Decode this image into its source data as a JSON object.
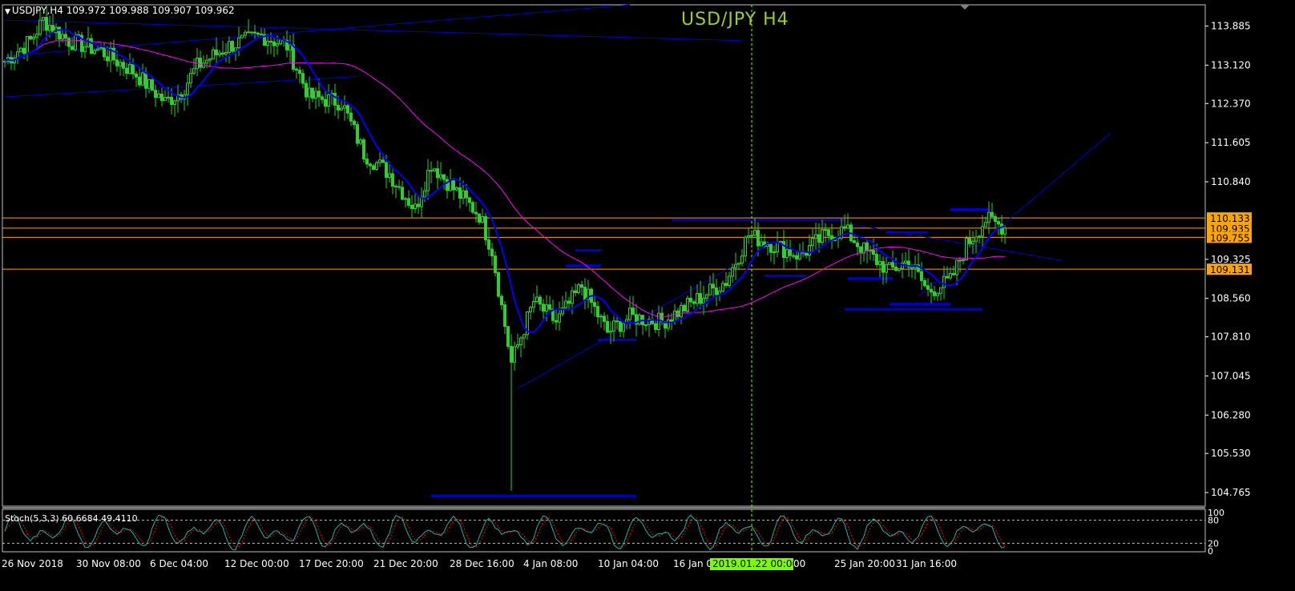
{
  "header": {
    "symbol": "USDJPY,H4",
    "ohlc": "109.972 109.988 109.907 109.962"
  },
  "title": "USD/JPY  H4",
  "stoch_label": "Stoch(5,3,3) 60.6684 49.4110",
  "colors": {
    "background": "#000000",
    "candle": "#32cd32",
    "ma_fast": "#0000ff",
    "ma_slow": "#ff00ff",
    "trendline": "#0000cd",
    "level_line": "#ffa500",
    "grid_text": "#ffffff",
    "title": "#9acd32",
    "crosshair": "#7cfc00"
  },
  "chart_data": [
    {
      "type": "candlestick",
      "title": "USD/JPY  H4",
      "y_ticks": [
        "113.885",
        "113.120",
        "112.370",
        "111.605",
        "110.840",
        "109.325",
        "108.560",
        "107.810",
        "107.045",
        "106.280",
        "105.530",
        "104.765"
      ],
      "ylim": [
        104.5,
        114.3
      ],
      "x_ticks": [
        "26 Nov 2018",
        "30 Nov 08:00",
        "6 Dec 04:00",
        "12 Dec 00:00",
        "17 Dec 20:00",
        "21 Dec 20:00",
        "28 Dec 16:00",
        "4 Jan 08:00",
        "10 Jan 04:00",
        "16 Jan 0",
        "2019.01.22 00:00",
        "25 Jan 20:00",
        "31 Jan 16:00"
      ],
      "x_tick_partial": "00",
      "crosshair_label": "2019.01.22 00:00",
      "price_levels": [
        {
          "value": 110.133,
          "label": "110.133"
        },
        {
          "value": 109.935,
          "label": "109.935"
        },
        {
          "value": 109.755,
          "label": "109.755"
        },
        {
          "value": 109.131,
          "label": "109.131"
        }
      ],
      "key_prices": [
        {
          "x": 0,
          "price": 113.2
        },
        {
          "x": 8,
          "price": 113.6
        },
        {
          "x": 12,
          "price": 114.0
        },
        {
          "x": 20,
          "price": 113.6
        },
        {
          "x": 30,
          "price": 113.4
        },
        {
          "x": 40,
          "price": 113.0
        },
        {
          "x": 50,
          "price": 112.4
        },
        {
          "x": 55,
          "price": 112.6
        },
        {
          "x": 60,
          "price": 113.1
        },
        {
          "x": 70,
          "price": 113.5
        },
        {
          "x": 80,
          "price": 113.7
        },
        {
          "x": 88,
          "price": 113.5
        },
        {
          "x": 95,
          "price": 112.5
        },
        {
          "x": 105,
          "price": 112.4
        },
        {
          "x": 112,
          "price": 111.4
        },
        {
          "x": 120,
          "price": 111.0
        },
        {
          "x": 128,
          "price": 110.3
        },
        {
          "x": 133,
          "price": 111.2
        },
        {
          "x": 140,
          "price": 110.7
        },
        {
          "x": 148,
          "price": 110.2
        },
        {
          "x": 152,
          "price": 109.5
        },
        {
          "x": 158,
          "price": 107.3
        },
        {
          "x": 165,
          "price": 108.5
        },
        {
          "x": 172,
          "price": 108.1
        },
        {
          "x": 180,
          "price": 108.8
        },
        {
          "x": 188,
          "price": 107.9
        },
        {
          "x": 195,
          "price": 108.2
        },
        {
          "x": 205,
          "price": 108.1
        },
        {
          "x": 215,
          "price": 108.5
        },
        {
          "x": 225,
          "price": 108.9
        },
        {
          "x": 232,
          "price": 109.8
        },
        {
          "x": 240,
          "price": 109.6
        },
        {
          "x": 248,
          "price": 109.4
        },
        {
          "x": 256,
          "price": 109.8
        },
        {
          "x": 262,
          "price": 109.9
        },
        {
          "x": 268,
          "price": 109.5
        },
        {
          "x": 276,
          "price": 109.1
        },
        {
          "x": 282,
          "price": 109.3
        },
        {
          "x": 288,
          "price": 108.7
        },
        {
          "x": 295,
          "price": 108.9
        },
        {
          "x": 300,
          "price": 109.6
        },
        {
          "x": 306,
          "price": 110.1
        },
        {
          "x": 312,
          "price": 109.95
        }
      ],
      "wick_low": {
        "x": 158,
        "price": 104.8
      },
      "candle_count": 313,
      "series": [
        {
          "kind": "ma_fast",
          "values_desc": "short moving average tracking price"
        },
        {
          "kind": "ma_slow",
          "values_desc": "long moving average"
        }
      ],
      "trendlines": [
        {
          "from": {
            "x": 0,
            "price": 114.0
          },
          "to": {
            "x": 230,
            "price": 113.6
          }
        },
        {
          "from": {
            "x": 0,
            "price": 113.3
          },
          "to": {
            "x": 195,
            "price": 114.3
          }
        },
        {
          "from": {
            "x": 0,
            "price": 112.5
          },
          "to": {
            "x": 110,
            "price": 112.9
          }
        },
        {
          "from": {
            "x": 160,
            "price": 106.8
          },
          "to": {
            "x": 230,
            "price": 109.3
          }
        },
        {
          "from": {
            "x": 265,
            "price": 110.0
          },
          "to": {
            "x": 330,
            "price": 109.3
          }
        },
        {
          "from": {
            "x": 285,
            "price": 108.6
          },
          "to": {
            "x": 345,
            "price": 111.8
          }
        }
      ],
      "horizontal_segments": [
        {
          "x1": 133,
          "x2": 197,
          "price": 104.7
        },
        {
          "x1": 178,
          "x2": 186,
          "price": 109.5
        },
        {
          "x1": 175,
          "x2": 186,
          "price": 109.2
        },
        {
          "x1": 185,
          "x2": 197,
          "price": 107.75
        },
        {
          "x1": 208,
          "x2": 262,
          "price": 110.1
        },
        {
          "x1": 237,
          "x2": 250,
          "price": 109.0
        },
        {
          "x1": 262,
          "x2": 305,
          "price": 108.35
        },
        {
          "x1": 295,
          "x2": 307,
          "price": 110.3
        },
        {
          "x1": 275,
          "x2": 288,
          "price": 109.85
        },
        {
          "x1": 263,
          "x2": 277,
          "price": 108.95
        },
        {
          "x1": 276,
          "x2": 295,
          "price": 108.45
        }
      ],
      "stochastic": {
        "name": "Stoch(5,3,3)",
        "main": 60.6684,
        "signal": 49.411,
        "levels": [
          80,
          20
        ],
        "scale_labels": [
          "100",
          "80",
          "20",
          "0"
        ]
      }
    }
  ]
}
